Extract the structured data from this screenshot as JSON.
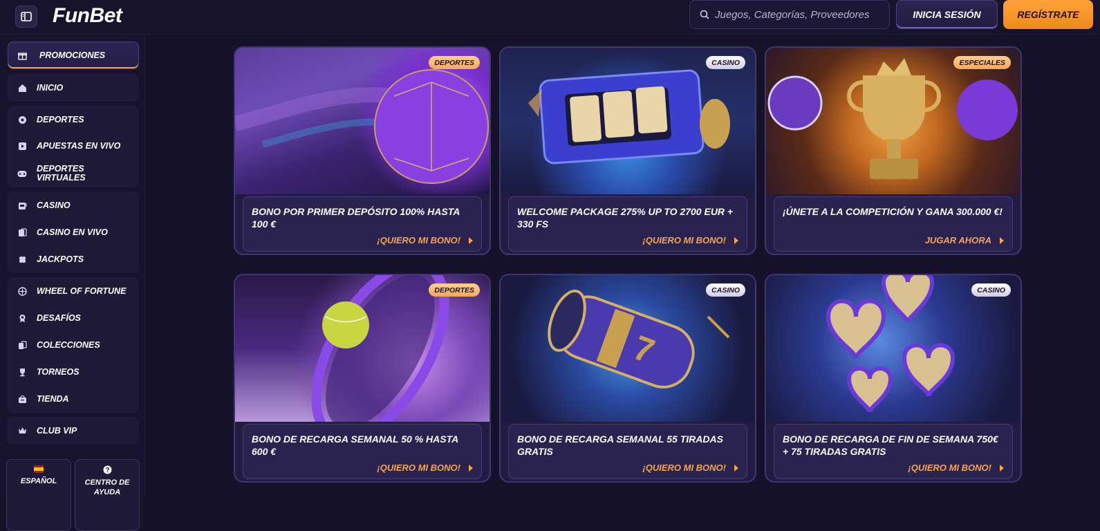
{
  "header": {
    "logo": "FunBet",
    "search_placeholder": "Juegos, Categorías, Proveedores",
    "login_label": "INICIA SESIÓN",
    "register_label": "REGÍSTRATE"
  },
  "sidebar": {
    "promo": "PROMOCIONES",
    "inicio": "INICIO",
    "deportes": "DEPORTES",
    "apuestas_vivo": "APUESTAS EN VIVO",
    "deportes_virtuales": "DEPORTES VIRTUALES",
    "casino": "CASINO",
    "casino_vivo": "CASINO EN VIVO",
    "jackpots": "JACKPOTS",
    "wheel": "WHEEL OF FORTUNE",
    "desafios": "DESAFÍOS",
    "colecciones": "COLECCIONES",
    "torneos": "TORNEOS",
    "tienda": "TIENDA",
    "club_vip": "CLUB VIP",
    "language": "ESPAÑOL",
    "help": "CENTRO DE AYUDA"
  },
  "cards": [
    {
      "badge": "DEPORTES",
      "title": "BONO POR PRIMER DEPÓSITO 100% HASTA 100 €",
      "cta": "¡QUIERO MI BONO!"
    },
    {
      "badge": "CASINO",
      "title": "WELCOME PACKAGE 275% UP TO 2700 EUR + 330 FS",
      "cta": "¡QUIERO MI BONO!"
    },
    {
      "badge": "ESPECIALES",
      "title": "¡ÚNETE A LA COMPETICIÓN Y GANA 300.000 €!",
      "cta": "JUGAR AHORA"
    },
    {
      "badge": "DEPORTES",
      "title": "BONO DE RECARGA SEMANAL 50 % HASTA 600 €",
      "cta": "¡QUIERO MI BONO!"
    },
    {
      "badge": "CASINO",
      "title": "BONO DE RECARGA SEMANAL 55 TIRADAS GRATIS",
      "cta": "¡QUIERO MI BONO!"
    },
    {
      "badge": "CASINO",
      "title": "BONO DE RECARGA DE FIN DE SEMANA 750€ + 75 TIRADAS GRATIS",
      "cta": "¡QUIERO MI BONO!"
    }
  ],
  "colors": {
    "accent": "#f4a64a",
    "background": "#15122a",
    "card": "#221c42"
  }
}
